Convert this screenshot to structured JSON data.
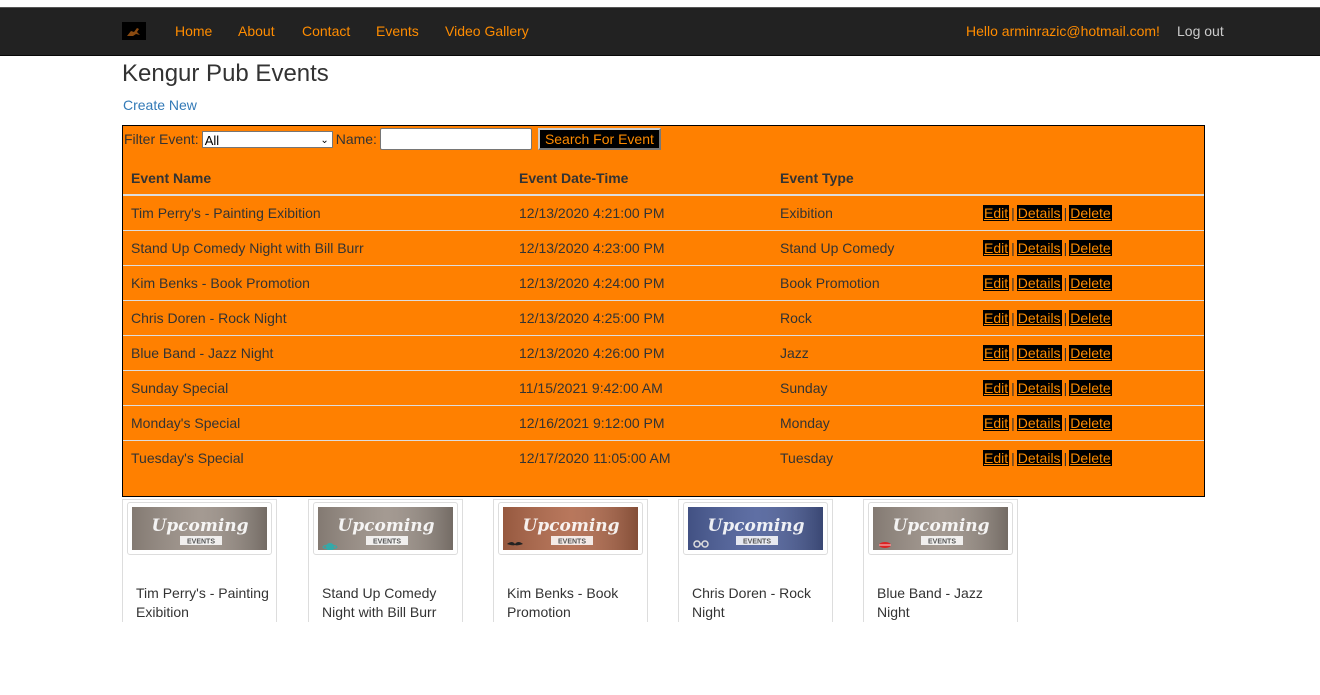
{
  "nav": {
    "links": [
      "Home",
      "About",
      "Contact",
      "Events",
      "Video Gallery"
    ],
    "greeting": "Hello arminrazic@hotmail.com!",
    "logout": "Log out",
    "link_color": "#ff8c00",
    "bar_color": "#222222"
  },
  "page": {
    "title": "Kengur Pub Events",
    "create_new": "Create New"
  },
  "filter": {
    "event_label": "Filter Event:",
    "selected": "All",
    "name_label": "Name:",
    "name_value": "",
    "search_button": "Search For Event"
  },
  "table": {
    "headers": [
      "Event Name",
      "Event Date-Time",
      "Event Type"
    ],
    "actions": [
      "Edit",
      "Details",
      "Delete"
    ],
    "rows": [
      {
        "name": "Tim Perry's - Painting Exibition",
        "datetime": "12/13/2020 4:21:00 PM",
        "type": "Exibition"
      },
      {
        "name": "Stand Up Comedy Night with Bill Burr",
        "datetime": "12/13/2020 4:23:00 PM",
        "type": "Stand Up Comedy"
      },
      {
        "name": "Kim Benks - Book Promotion",
        "datetime": "12/13/2020 4:24:00 PM",
        "type": "Book Promotion"
      },
      {
        "name": "Chris Doren - Rock Night",
        "datetime": "12/13/2020 4:25:00 PM",
        "type": "Rock"
      },
      {
        "name": "Blue Band - Jazz Night",
        "datetime": "12/13/2020 4:26:00 PM",
        "type": "Jazz"
      },
      {
        "name": "Sunday Special",
        "datetime": "11/15/2021 9:42:00 AM",
        "type": "Sunday"
      },
      {
        "name": "Monday's Special",
        "datetime": "12/16/2021 9:12:00 PM",
        "type": "Monday"
      },
      {
        "name": "Tuesday's Special",
        "datetime": "12/17/2020 11:05:00 AM",
        "type": "Tuesday"
      }
    ],
    "panel_color": "#ff8000"
  },
  "cards": {
    "banner_text": "Upcoming",
    "banner_subtext": "EVENTS",
    "items": [
      {
        "title": "Tim Perry's - Painting Exibition",
        "tint": "#9a8f86",
        "icon": "none"
      },
      {
        "title": "Stand Up Comedy Night with Bill Burr",
        "tint": "#9a8f86",
        "icon": "planet-icon"
      },
      {
        "title": "Kim Benks - Book Promotion",
        "tint": "#b0684a",
        "icon": "mustache-icon"
      },
      {
        "title": "Chris Doren - Rock Night",
        "tint": "#4d5f9a",
        "icon": "glasses-icon"
      },
      {
        "title": "Blue Band - Jazz Night",
        "tint": "#9a8f86",
        "icon": "lips-icon"
      }
    ]
  }
}
